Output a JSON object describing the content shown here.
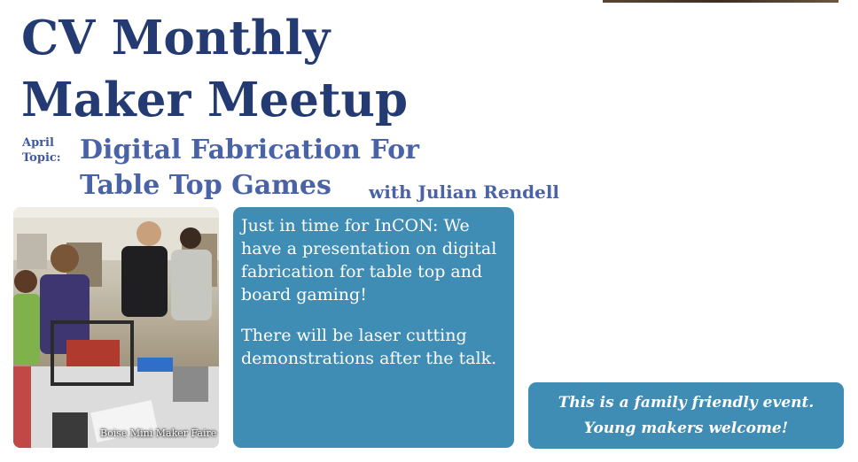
{
  "header": {
    "title_line1": "CV Monthly",
    "title_line2": "Maker Meetup"
  },
  "topic": {
    "label_line1": "April",
    "label_line2": "Topic:",
    "title_line1": "Digital Fabrication For",
    "title_line2": "Table Top Games",
    "presenter": "with Julian Rendell"
  },
  "photo": {
    "caption": "Boise Mini Maker Faire"
  },
  "description": {
    "paragraph1": "Just in time for InCON: We have a presentation on digital fabrication for table top and board gaming!",
    "paragraph2": "There will be laser cutting demonstrations after the talk."
  },
  "notice": {
    "line1": "This is a family friendly event.",
    "line2": "Young makers welcome!"
  },
  "colors": {
    "title": "#243a73",
    "topic": "#4a63a8",
    "box": "#3f8cb4"
  }
}
